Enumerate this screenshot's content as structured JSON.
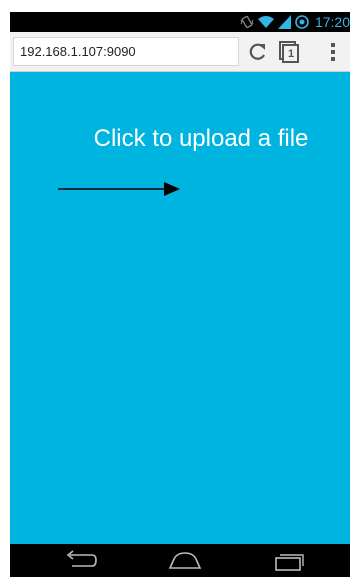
{
  "status_bar": {
    "time": "17:20",
    "icons": [
      "vibrate-icon",
      "wifi-icon",
      "signal-icon",
      "battery-icon"
    ]
  },
  "browser": {
    "url": "192.168.1.107:9090",
    "tab_count": "1",
    "icons": [
      "reload-icon",
      "tabs-icon",
      "overflow-menu-icon"
    ]
  },
  "page": {
    "upload_label": "Click to upload a file",
    "background_color": "#00b4e0",
    "arrow_icon": "right-arrow-icon"
  },
  "nav_bar": {
    "icons": [
      "back-icon",
      "home-icon",
      "recent-apps-icon"
    ]
  },
  "colors": {
    "accent": "#33b5e5",
    "page_background": "#00b4e0"
  }
}
